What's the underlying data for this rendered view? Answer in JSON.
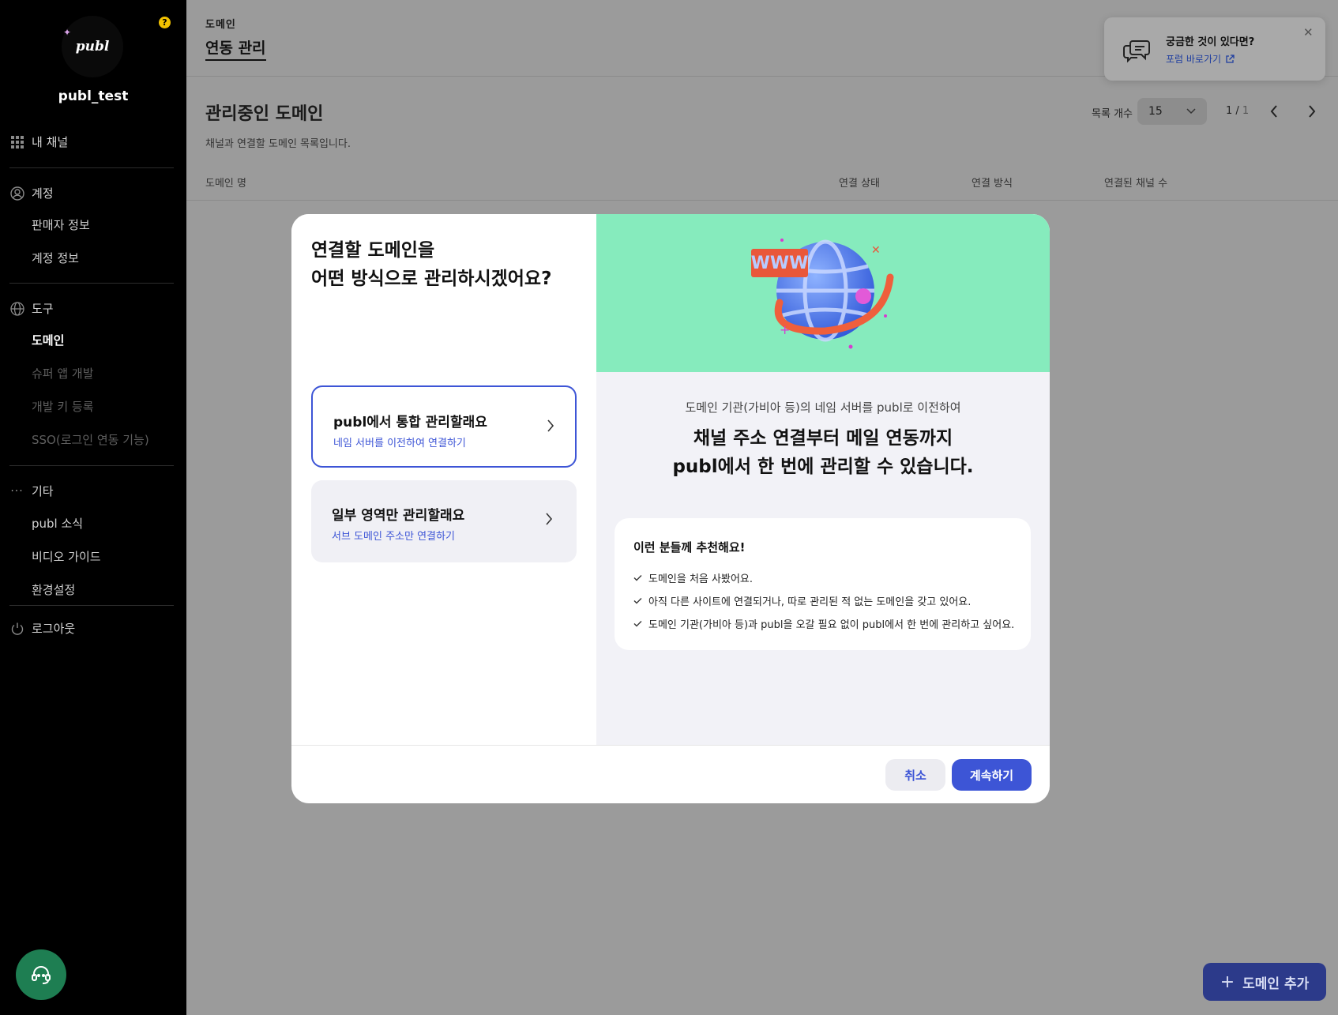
{
  "sidebar": {
    "logo_text": "publ",
    "help_badge": "?",
    "username": "publ_test",
    "my_channel": "내 채널",
    "account": {
      "label": "계정",
      "items": [
        "판매자 정보",
        "계정 정보"
      ]
    },
    "tools": {
      "label": "도구",
      "items": [
        "도메인",
        "슈퍼 앱 개발",
        "개발 키 등록",
        "SSO(로그인 연동 기능)"
      ]
    },
    "etc": {
      "label": "기타",
      "items": [
        "publ 소식",
        "비디오 가이드",
        "환경설정"
      ]
    },
    "logout": "로그아웃"
  },
  "header": {
    "breadcrumb": "도메인",
    "title": "연동 관리"
  },
  "section": {
    "title": "관리중인 도메인",
    "description": "채널과 연결할 도메인 목록입니다.",
    "list_count_label": "목록 개수",
    "list_count_value": "15",
    "page_current": "1 /",
    "page_total": " 1",
    "columns": [
      "도메인 명",
      "연결 상태",
      "연결 방식",
      "연결된 채널 수"
    ]
  },
  "toast": {
    "title": "궁금한 것이 있다면?",
    "link": "포럼 바로가기"
  },
  "add_button": "도메인 추가",
  "modal": {
    "title_line1": "연결할 도메인을",
    "title_line2": "어떤 방식으로 관리하시겠어요?",
    "options": [
      {
        "title": "publ에서 통합 관리할래요",
        "subtitle": "네임 서버를 이전하여 연결하기"
      },
      {
        "title": "일부 영역만 관리할래요",
        "subtitle": "서브 도메인 주소만 연결하기"
      }
    ],
    "hero_badge": "WWW",
    "desc_small": "도메인 기관(가비아 등)의 네임 서버를 publ로 이전하여",
    "desc_big_line1": "채널 주소 연결부터 메일 연동까지",
    "desc_big_line2": "publ에서 한 번에 관리할 수 있습니다.",
    "recommend_title": "이런 분들께 추천해요!",
    "recommend_items": [
      "도메인을 처음 사봤어요.",
      "아직 다른 사이트에 연결되거나, 따로 관리된 적 없는 도메인을 갖고 있어요.",
      "도메인 기관(가비아 등)과 publ을 오갈 필요 없이 publ에서 한 번에 관리하고 싶어요."
    ],
    "cancel": "취소",
    "continue": "계속하기"
  },
  "colors": {
    "accent": "#3d55d6",
    "hero_bg": "#86ebbd",
    "sidebar_bg": "#000000",
    "support_fab": "#1e7e52"
  }
}
